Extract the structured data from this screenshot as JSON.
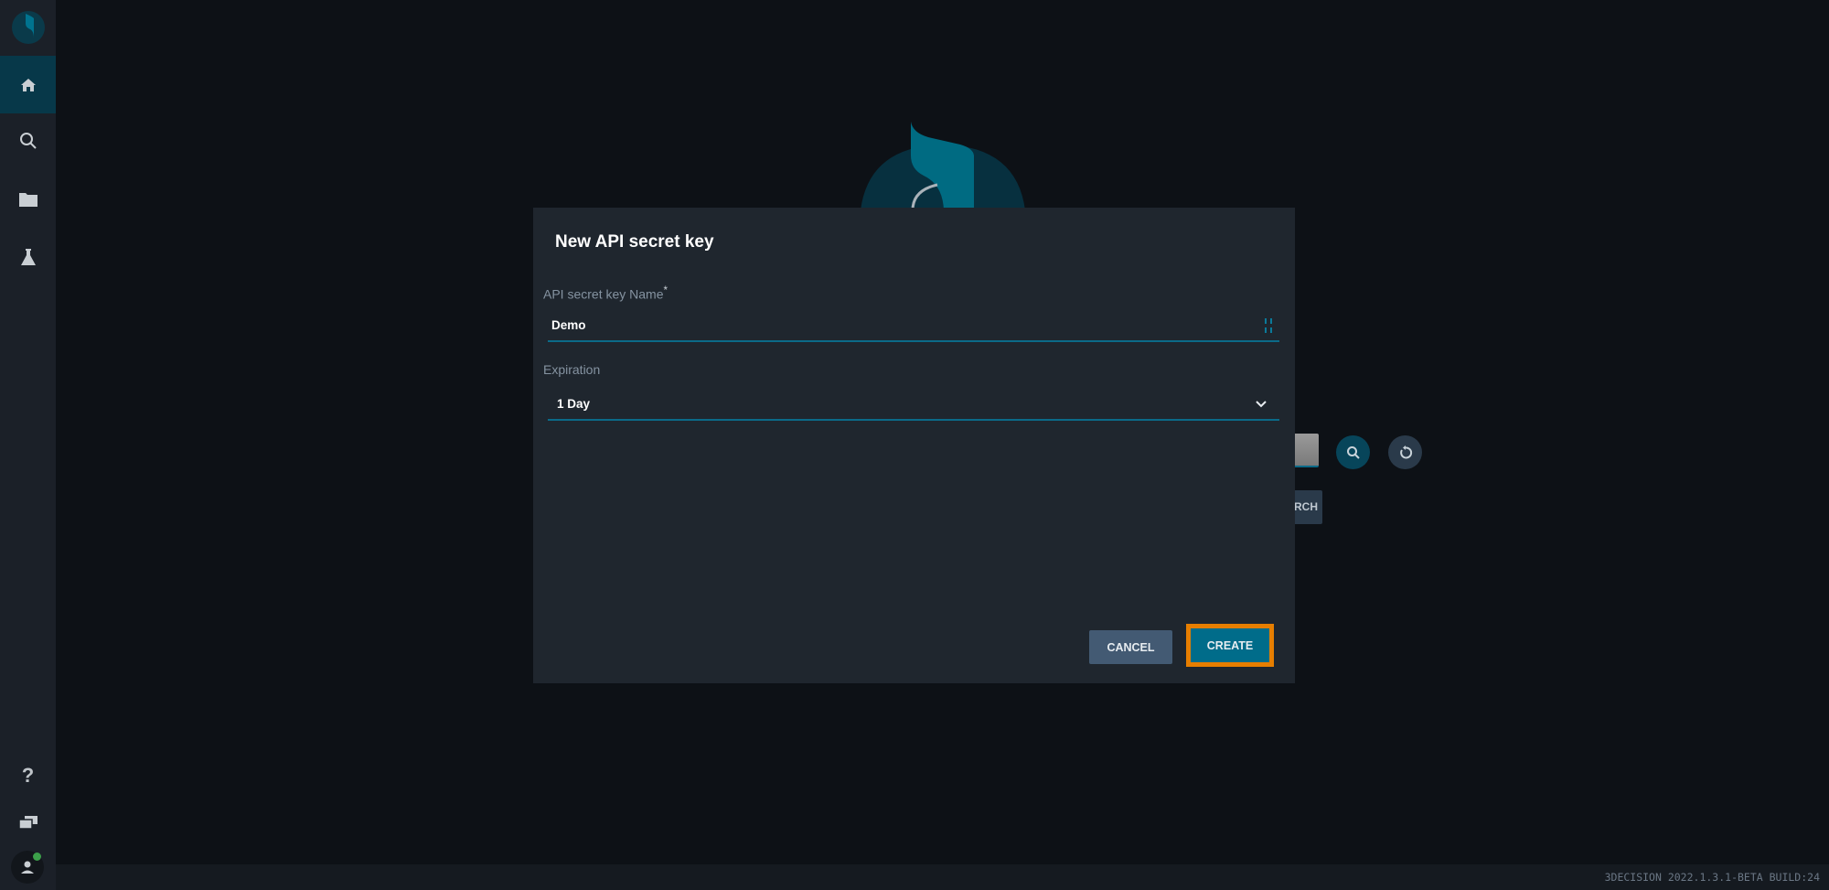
{
  "sidebar": {
    "items": [
      {
        "icon": "home-icon",
        "active": true
      },
      {
        "icon": "search-icon"
      },
      {
        "icon": "folder-icon"
      },
      {
        "icon": "flask-icon"
      }
    ],
    "bottom": [
      {
        "icon": "help-icon",
        "glyph": "?"
      },
      {
        "icon": "chat-icon"
      },
      {
        "icon": "user-avatar-icon",
        "status_color": "#3ca04a"
      }
    ]
  },
  "background": {
    "search_button_partial": "RCH"
  },
  "dialog": {
    "title": "New API secret key",
    "name_label": "API secret key Name",
    "required_mark": "*",
    "name_value": "Demo",
    "expiration_label": "Expiration",
    "expiration_value": "1 Day",
    "cancel_label": "CANCEL",
    "create_label": "CREATE"
  },
  "colors": {
    "accent": "#006c8a",
    "highlight": "#e67e00",
    "cancel": "#435a73"
  },
  "status": {
    "version": "3DECISION 2022.1.3.1-BETA BUILD:24"
  }
}
